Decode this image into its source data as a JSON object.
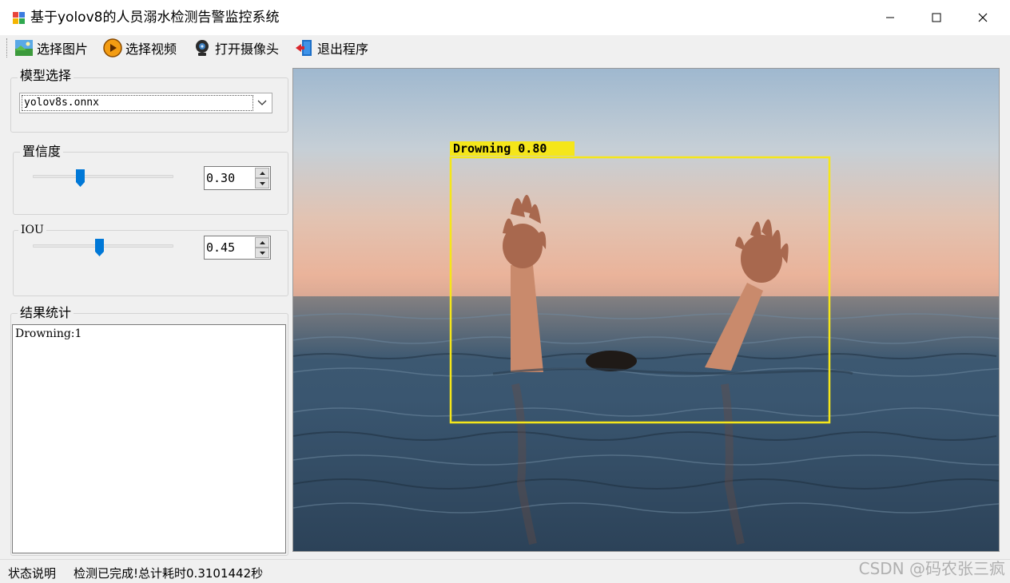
{
  "window": {
    "title": "基于yolov8的人员溺水检测告警监控系统",
    "controls": [
      "minimize",
      "maximize",
      "close"
    ]
  },
  "toolbar": {
    "items": [
      {
        "label": "选择图片",
        "icon": "image-icon"
      },
      {
        "label": "选择视频",
        "icon": "video-icon"
      },
      {
        "label": "打开摄像头",
        "icon": "camera-icon"
      },
      {
        "label": "退出程序",
        "icon": "exit-icon"
      }
    ]
  },
  "model": {
    "group_label": "模型选择",
    "selected": "yolov8s.onnx"
  },
  "confidence": {
    "group_label": "置信度",
    "value": "0.30",
    "slider_fraction": 0.3
  },
  "iou": {
    "group_label": "IOU",
    "value": "0.45",
    "slider_fraction": 0.45
  },
  "results": {
    "group_label": "结果统计",
    "text": "Drowning:1"
  },
  "detection": {
    "label": "Drowning 0.80",
    "box_color": "#f5e61a"
  },
  "status": {
    "label": "状态说明",
    "message": "检测已完成!总计耗时0.3101442秒"
  },
  "watermark": "CSDN @码农张三疯",
  "colors": {
    "accent": "#0078d7"
  }
}
